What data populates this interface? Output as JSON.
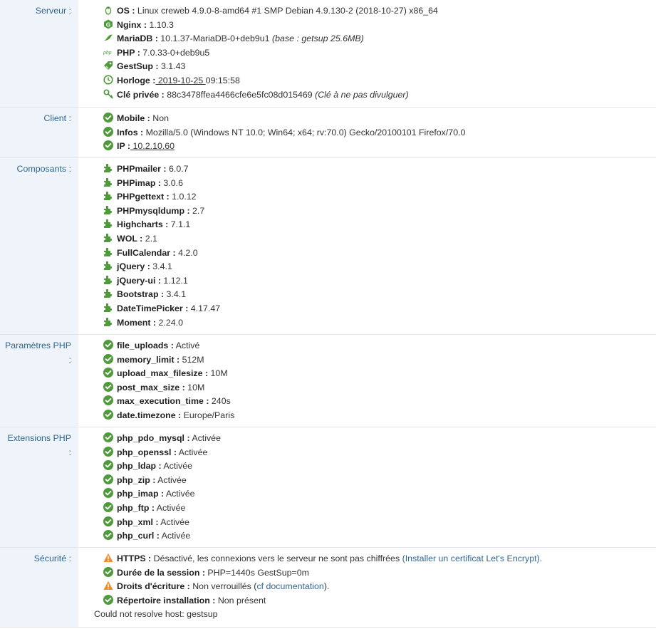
{
  "colors": {
    "label_bg": "#eef4fa",
    "label_text": "#2f6694",
    "ok_green": "#4f9a3a",
    "warn_orange": "#f08c2b",
    "link": "#2f6694"
  },
  "sections": [
    {
      "label": "Serveur :",
      "items": [
        {
          "icon": "linux-icon",
          "key": "OS :",
          "value": " Linux creweb 4.9.0-8-amd64 #1 SMP Debian 4.9.130-2 (2018-10-27) x86_64"
        },
        {
          "icon": "nginx-icon",
          "key": "Nginx :",
          "value": " 1.10.3"
        },
        {
          "icon": "mariadb-icon",
          "key": "MariaDB :",
          "value": " 10.1.37-MariaDB-0+deb9u1 ",
          "extra": "(base : getsup 25.6MB)"
        },
        {
          "icon": "php-icon",
          "key": "PHP :",
          "value": " 7.0.33-0+deb9u5"
        },
        {
          "icon": "gestsup-icon",
          "key": "GestSup :",
          "value": " 3.1.43"
        },
        {
          "icon": "clock-icon",
          "key": "Horloge :",
          "value_u": " 2019-10-25 ",
          "value": "09:15:58"
        },
        {
          "icon": "key-icon",
          "key": "Clé privée :",
          "value": " 88c3478ffea4466cfe6e5fc08d015469 ",
          "extra": "(Clé à ne pas divulguer)"
        }
      ]
    },
    {
      "label": "Client :",
      "items": [
        {
          "icon": "check-circle-icon",
          "key": "Mobile :",
          "value": " Non"
        },
        {
          "icon": "check-circle-icon",
          "key": "Infos :",
          "value": " Mozilla/5.0 (Windows NT 10.0; Win64; x64; rv:70.0) Gecko/20100101 Firefox/70.0"
        },
        {
          "icon": "check-circle-icon",
          "key": "IP :",
          "value_u": " 10.2.10.60"
        }
      ]
    },
    {
      "label": "Composants :",
      "items": [
        {
          "icon": "puzzle-icon",
          "key": "PHPmailer :",
          "value": " 6.0.7"
        },
        {
          "icon": "puzzle-icon",
          "key": "PHPimap :",
          "value": " 3.0.6"
        },
        {
          "icon": "puzzle-icon",
          "key": "PHPgettext :",
          "value": " 1.0.12"
        },
        {
          "icon": "puzzle-icon",
          "key": "PHPmysqldump :",
          "value": " 2.7"
        },
        {
          "icon": "puzzle-icon",
          "key": "Highcharts :",
          "value": " 7.1.1"
        },
        {
          "icon": "puzzle-icon",
          "key": "WOL :",
          "value": " 2.1"
        },
        {
          "icon": "puzzle-icon",
          "key": "FullCalendar :",
          "value": " 4.2.0"
        },
        {
          "icon": "puzzle-icon",
          "key": "jQuery :",
          "value": " 3.4.1"
        },
        {
          "icon": "puzzle-icon",
          "key": "jQuery-ui :",
          "value": " 1.12.1"
        },
        {
          "icon": "puzzle-icon",
          "key": "Bootstrap :",
          "value": " 3.4.1"
        },
        {
          "icon": "puzzle-icon",
          "key": "DateTimePicker :",
          "value": " 4.17.47"
        },
        {
          "icon": "puzzle-icon",
          "key": "Moment :",
          "value": " 2.24.0"
        }
      ]
    },
    {
      "label": "Paramètres PHP :",
      "items": [
        {
          "icon": "check-circle-icon",
          "key": "file_uploads :",
          "value": " Activé"
        },
        {
          "icon": "check-circle-icon",
          "key": "memory_limit :",
          "value": " 512M"
        },
        {
          "icon": "check-circle-icon",
          "key": "upload_max_filesize :",
          "value": " 10M"
        },
        {
          "icon": "check-circle-icon",
          "key": "post_max_size :",
          "value": " 10M"
        },
        {
          "icon": "check-circle-icon",
          "key": "max_execution_time :",
          "value": " 240s"
        },
        {
          "icon": "check-circle-icon",
          "key": "date.timezone :",
          "value": " Europe/Paris"
        }
      ]
    },
    {
      "label": "Extensions PHP :",
      "items": [
        {
          "icon": "check-circle-icon",
          "key": "php_pdo_mysql :",
          "value": " Activée"
        },
        {
          "icon": "check-circle-icon",
          "key": "php_openssl :",
          "value": " Activée"
        },
        {
          "icon": "check-circle-icon",
          "key": "php_ldap :",
          "value": " Activée"
        },
        {
          "icon": "check-circle-icon",
          "key": "php_zip :",
          "value": " Activée"
        },
        {
          "icon": "check-circle-icon",
          "key": "php_imap :",
          "value": " Activée"
        },
        {
          "icon": "check-circle-icon",
          "key": "php_ftp :",
          "value": " Activée"
        },
        {
          "icon": "check-circle-icon",
          "key": "php_xml :",
          "value": " Activée"
        },
        {
          "icon": "check-circle-icon",
          "key": "php_curl :",
          "value": " Activée"
        }
      ]
    },
    {
      "label": "Sécurité :",
      "items": [
        {
          "icon": "warning-icon",
          "key": "HTTPS :",
          "value": " Désactivé, les connexions vers le serveur ne sont pas chiffrées ",
          "link": "(Installer un certificat Let's Encrypt)",
          "after": "."
        },
        {
          "icon": "check-circle-icon",
          "key": "Durée de la session :",
          "value": " PHP=1440s GestSup=0m"
        },
        {
          "icon": "warning-icon",
          "key": "Droits d'écriture :",
          "value": " Non verrouillés (",
          "link": "cf documentation",
          "after": ")."
        },
        {
          "icon": "check-circle-icon",
          "key": "Répertoire installation :",
          "value": " Non présent"
        }
      ],
      "footer": "Could not resolve host: gestsup"
    }
  ]
}
